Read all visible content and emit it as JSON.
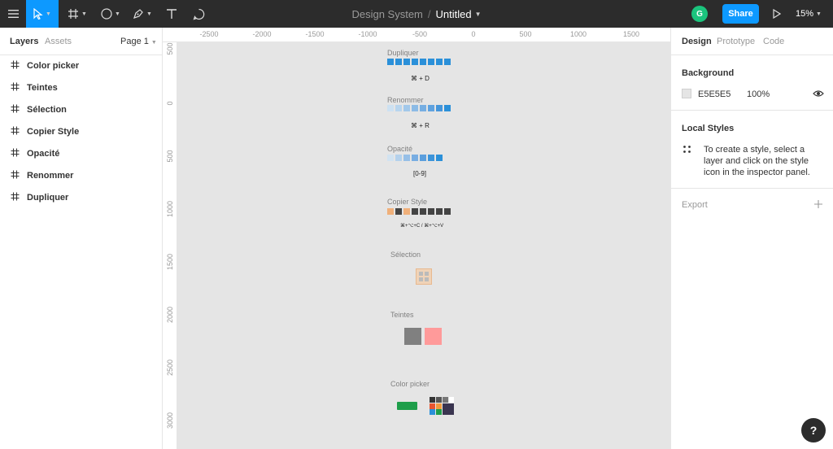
{
  "toolbar": {
    "project_name": "Design System",
    "separator": "/",
    "file_name": "Untitled",
    "avatar_letter": "G",
    "share_label": "Share",
    "zoom": "15%",
    "icons": [
      "menu-icon",
      "move-tool-icon",
      "frame-tool-icon",
      "shape-tool-icon",
      "pen-tool-icon",
      "text-tool-icon",
      "comment-tool-icon",
      "play-icon"
    ]
  },
  "left_panel": {
    "tab_layers": "Layers",
    "tab_assets": "Assets",
    "page": "Page 1",
    "layers": [
      {
        "label": "Color picker"
      },
      {
        "label": "Teintes"
      },
      {
        "label": "Sélection"
      },
      {
        "label": "Copier Style"
      },
      {
        "label": "Opacité"
      },
      {
        "label": "Renommer"
      },
      {
        "label": "Dupliquer"
      }
    ]
  },
  "rulers": {
    "top": [
      "-2500",
      "-2000",
      "-1500",
      "-1000",
      "-500",
      "0",
      "500",
      "1000",
      "1500"
    ],
    "left": [
      "500",
      "0",
      "500",
      "1000",
      "1500",
      "2000",
      "2500",
      "3000"
    ]
  },
  "canvas": {
    "background": "#E5E5E5",
    "frames": [
      {
        "title": "Dupliquer",
        "shortcut": "⌘ + D"
      },
      {
        "title": "Renommer",
        "shortcut": "⌘ + R"
      },
      {
        "title": "Opacité",
        "shortcut": "[0-9]"
      },
      {
        "title": "Copier Style",
        "shortcut": "⌘+⌥+C / ⌘+⌥+V"
      },
      {
        "title": "Sélection"
      },
      {
        "title": "Teintes"
      },
      {
        "title": "Color picker"
      }
    ],
    "colors": {
      "blue": "#2b90d9",
      "orange": "#f0b07a",
      "dark": "#444444",
      "gray": "#808080",
      "salmon": "#ff9a9a",
      "green": "#1e9e4a"
    }
  },
  "right_panel": {
    "tab_design": "Design",
    "tab_prototype": "Prototype",
    "tab_code": "Code",
    "background_title": "Background",
    "background_hex": "E5E5E5",
    "background_opacity": "100%",
    "local_styles_title": "Local Styles",
    "local_styles_info": "To create a style, select a layer and click on the style icon in the inspector panel.",
    "export_title": "Export"
  }
}
